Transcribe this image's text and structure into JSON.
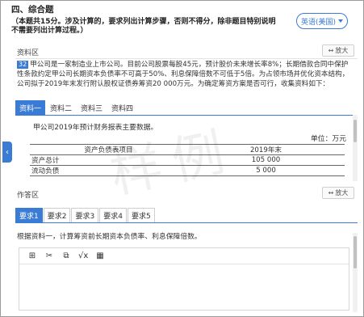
{
  "header": {
    "title": "四、综合题",
    "instructions": "（本题共15分。涉及计算的，要求列出计算步骤，否则不得分，除非题目特别说明不需要列出计算过程。）",
    "language_button": "英语(美国)"
  },
  "data_panel": {
    "label": "资料区",
    "zoom_label": "放大",
    "question_number": "32",
    "question_text": "甲公司是一家制造业上市公司。目前公司股票每股45元，预计股价未来增长率8%；长期借款合同中保护性条款约定甲公司长期资本负债率不可高于50%、利息保障倍数不可低于5倍。为占领市场并优化资本结构，公司拟于2019年末发行附认股权证债券筹资20 000万元。为确定筹资方案是否可行，收集资料如下：",
    "tabs": [
      "资料一",
      "资料二",
      "资料三",
      "资料四"
    ],
    "active_tab": 0,
    "caption": "甲公司2019年预计财务报表主要数据。",
    "unit": "单位：万元",
    "table": {
      "headers": [
        "资产负债表项目",
        "2019年末"
      ],
      "rows": [
        [
          "资产总计",
          "105 000"
        ],
        [
          "流动负债",
          "5 000"
        ]
      ]
    }
  },
  "answer_panel": {
    "label": "作答区",
    "zoom_label": "放大",
    "tabs": [
      "要求1",
      "要求2",
      "要求3",
      "要求4",
      "要求5"
    ],
    "active_tab": 0,
    "prompt": "根据资料一，计算筹资前长期资本负债率、利息保障倍数。",
    "toolbar": [
      "add-icon",
      "cut-icon",
      "copy-icon",
      "sqrt-icon",
      "table-icon"
    ]
  },
  "watermark": "样例"
}
